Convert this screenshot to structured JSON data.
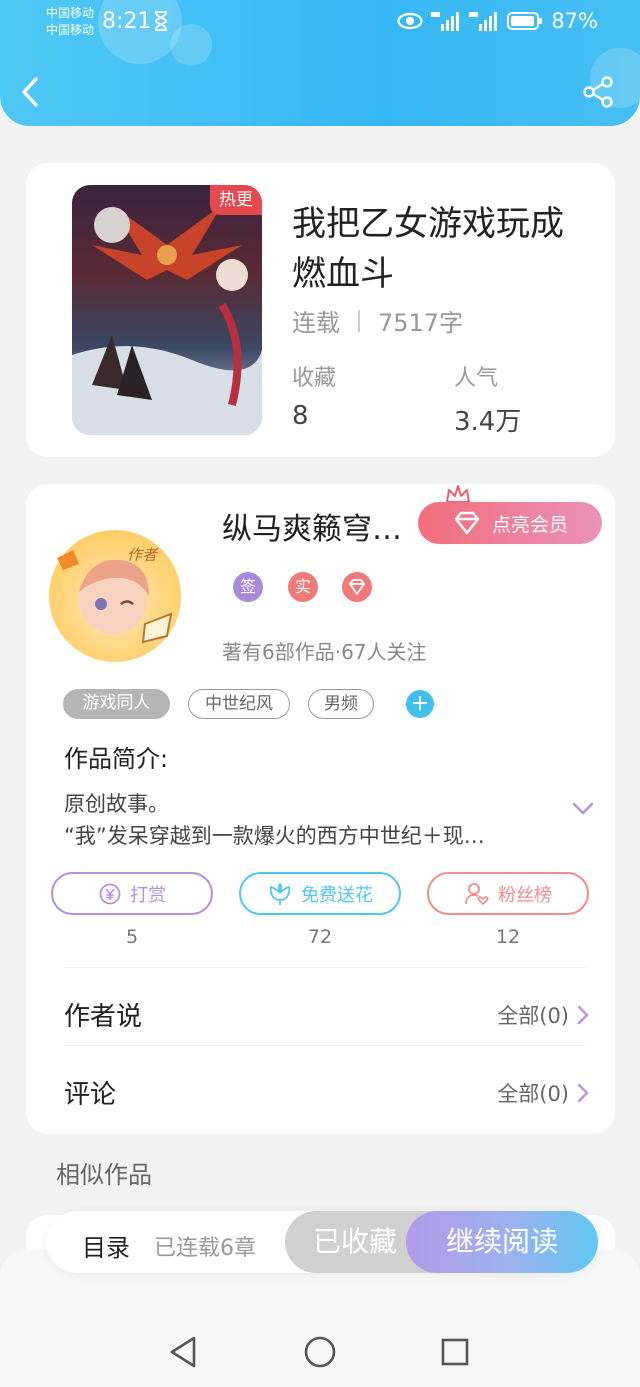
{
  "status_bar": {
    "carrier1": "中国移动",
    "carrier2": "中国移动",
    "time": "8:21",
    "battery": "87%"
  },
  "book": {
    "hot_badge": "热更",
    "title": "我把乙女游戏玩成燃血斗",
    "status": "连载",
    "word_count": "7517字",
    "favorites_label": "收藏",
    "favorites_value": "8",
    "popularity_label": "人气",
    "popularity_value": "3.4万"
  },
  "author": {
    "name": "纵马爽籁穹…",
    "avatar_caption": "作者",
    "vip_label": "点亮会员",
    "badges": [
      "签",
      "实"
    ],
    "follow_info": "著有6部作品·67人关注",
    "tags": [
      "游戏同人",
      "中世纪风",
      "男频"
    ],
    "intro_title": "作品简介:",
    "intro_line1": "原创故事。",
    "intro_line2": "“我”发呆穿越到一款爆火的西方中世纪＋现…"
  },
  "actions": [
    {
      "label": "打赏",
      "count": "5",
      "color": "#b48fe0"
    },
    {
      "label": "免费送花",
      "count": "72",
      "color": "#4fc6ee"
    },
    {
      "label": "粉丝榜",
      "count": "12",
      "color": "#ef8c8c"
    }
  ],
  "rows": {
    "author_says": "作者说",
    "author_says_link": "全部(0)",
    "comments": "评论",
    "comments_link": "全部(0)"
  },
  "similar_title": "相似作品",
  "bottom_bar": {
    "toc": "目录",
    "toc_sub": "已连载6章",
    "collected": "已收藏",
    "continue_reading": "继续阅读"
  }
}
